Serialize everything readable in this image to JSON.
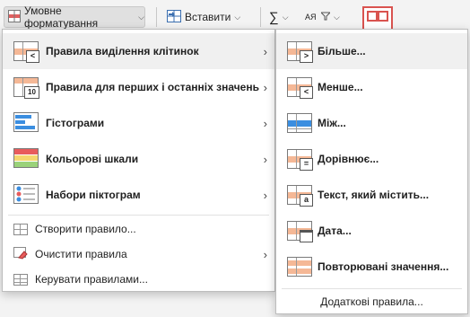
{
  "ribbon": {
    "conditional_formatting": "Умовне форматування",
    "insert": "Вставити",
    "sum_symbol": "∑",
    "sort_symbol": "AЯ"
  },
  "main_menu": {
    "items": [
      {
        "label": "Правила виділення клітинок"
      },
      {
        "label": "Правила для перших і останніх значень"
      },
      {
        "label": "Гістограми"
      },
      {
        "label": "Кольорові шкали"
      },
      {
        "label": "Набори піктограм"
      },
      {
        "label": "Створити правило..."
      },
      {
        "label": "Очистити правила"
      },
      {
        "label": "Керувати правилами..."
      }
    ],
    "icon_tags": {
      "top10": "10"
    }
  },
  "sub_menu": {
    "items": [
      {
        "label": "Більше...",
        "tag": ">"
      },
      {
        "label": "Менше...",
        "tag": "<"
      },
      {
        "label": "Між..."
      },
      {
        "label": "Дорівнює...",
        "tag": "="
      },
      {
        "label": "Текст, який містить...",
        "tag": "a"
      },
      {
        "label": "Дата..."
      },
      {
        "label": "Повторювані значення..."
      }
    ],
    "more_rules": "Додаткові правила..."
  },
  "colors": {
    "accent_orange": "#f5b896",
    "blue": "#3b8ee0",
    "red": "#d9534f"
  }
}
